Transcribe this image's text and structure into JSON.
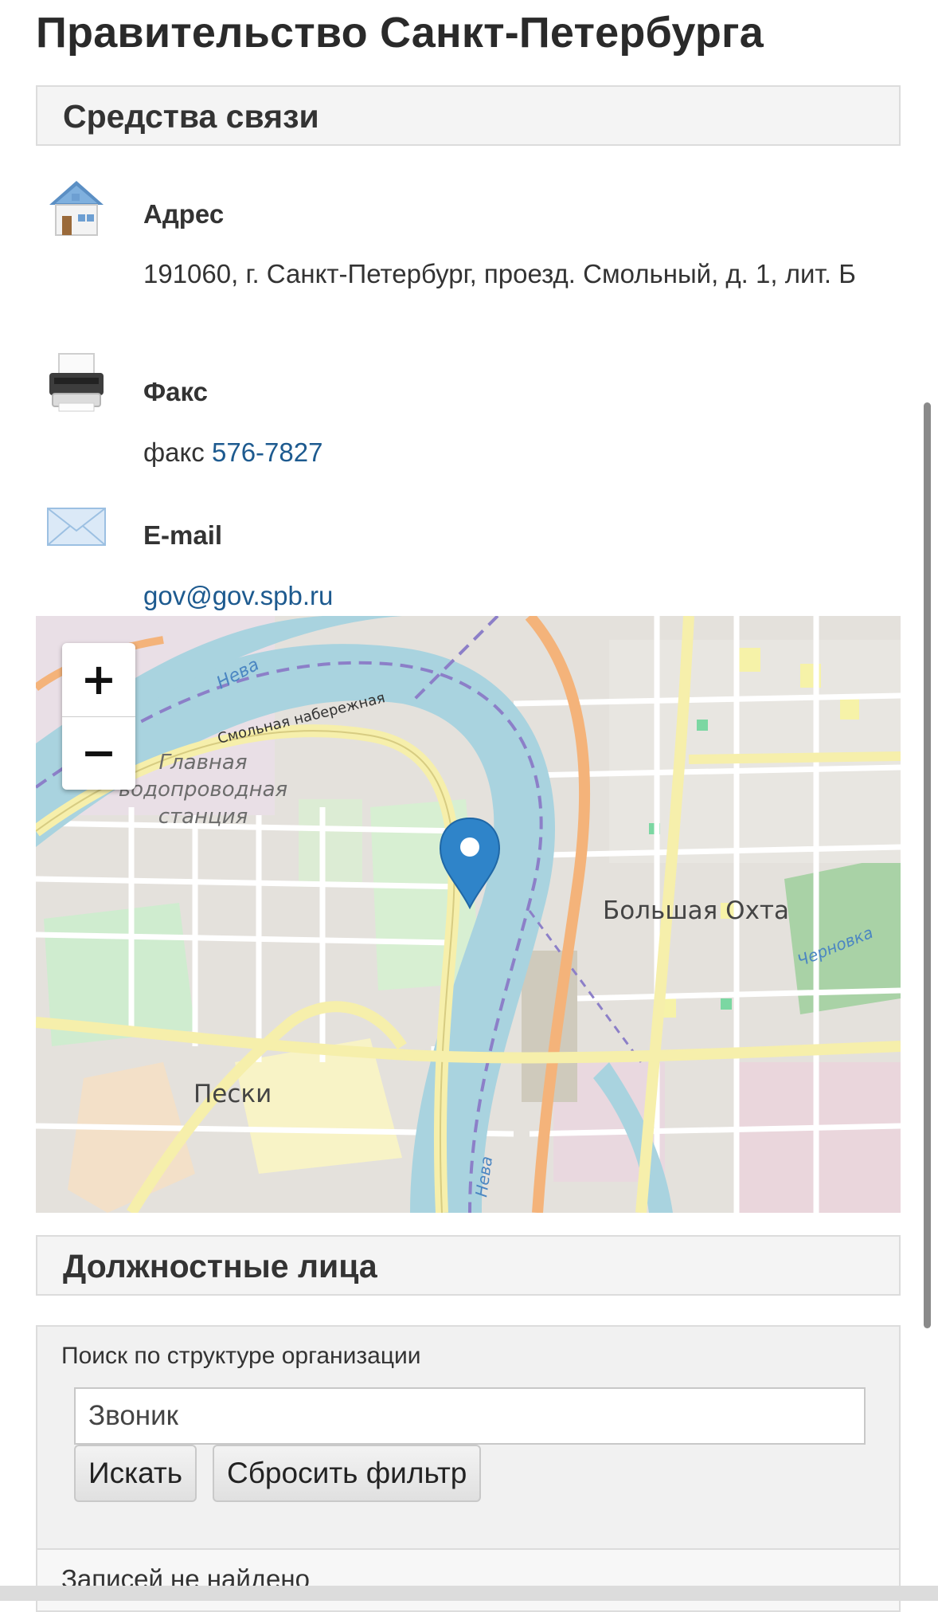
{
  "page": {
    "title": "Правительство Санкт-Петербурга"
  },
  "contacts": {
    "header": "Средства связи",
    "address": {
      "label": "Адрес",
      "value": "191060, г. Санкт-Петербург, проезд. Смольный, д. 1, лит. Б"
    },
    "fax": {
      "label": "Факс",
      "prefix": "факс",
      "number": "576-7827"
    },
    "email": {
      "label": "E-mail",
      "value": "gov@gov.spb.ru"
    }
  },
  "map": {
    "zoom_in": "+",
    "zoom_out": "−",
    "labels": {
      "neva_top": "Нева",
      "smolnaya": "Смольная набережная",
      "station_1": "Главная",
      "station_2": "водопроводная",
      "station_3": "станция",
      "bolshaya_okhta": "Большая Охта",
      "chernovka": "Черновка",
      "peski": "Пески",
      "neva_bottom": "Нева"
    },
    "colors": {
      "water": "#a9d3df",
      "marker": "#2f84c9"
    }
  },
  "officials": {
    "header": "Должностные лица",
    "search_label": "Поиск по структуре организации",
    "search_value": "Звоник",
    "search_button": "Искать",
    "reset_button": "Сбросить фильтр",
    "results_text": "Записей не найдено"
  }
}
